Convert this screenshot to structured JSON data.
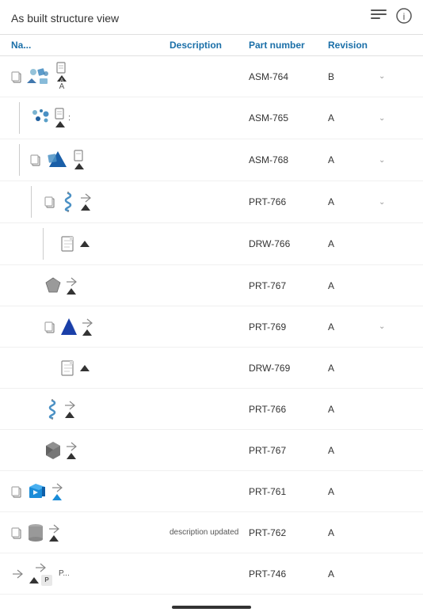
{
  "header": {
    "title": "As built structure view",
    "menu_icon": "≡",
    "info_icon": "ⓘ"
  },
  "columns": {
    "name": "Na...",
    "description": "Description",
    "part_number": "Part number",
    "revision": "Revision"
  },
  "rows": [
    {
      "id": "row-1",
      "indent": 0,
      "name": "A...",
      "description": "",
      "part_number": "ASM-764",
      "revision": "B",
      "has_expand": true,
      "type": "assembly"
    },
    {
      "id": "row-2",
      "indent": 1,
      "name": ":",
      "description": "",
      "part_number": "ASM-765",
      "revision": "A",
      "has_expand": true,
      "type": "sub-assembly"
    },
    {
      "id": "row-3",
      "indent": 1,
      "name": "",
      "description": "",
      "part_number": "ASM-768",
      "revision": "A",
      "has_expand": true,
      "type": "assembly2"
    },
    {
      "id": "row-4",
      "indent": 2,
      "name": "",
      "description": "",
      "part_number": "PRT-766",
      "revision": "A",
      "has_expand": true,
      "type": "spring"
    },
    {
      "id": "row-5",
      "indent": 3,
      "name": "",
      "description": "",
      "part_number": "DRW-766",
      "revision": "A",
      "has_expand": false,
      "type": "doc"
    },
    {
      "id": "row-6",
      "indent": 2,
      "name": "",
      "description": "",
      "part_number": "PRT-767",
      "revision": "A",
      "has_expand": false,
      "type": "prism"
    },
    {
      "id": "row-7",
      "indent": 2,
      "name": "",
      "description": "",
      "part_number": "PRT-769",
      "revision": "A",
      "has_expand": true,
      "type": "triangle"
    },
    {
      "id": "row-8",
      "indent": 3,
      "name": "",
      "description": "",
      "part_number": "DRW-769",
      "revision": "A",
      "has_expand": false,
      "type": "doc"
    },
    {
      "id": "row-9",
      "indent": 2,
      "name": "",
      "description": "",
      "part_number": "PRT-766",
      "revision": "A",
      "has_expand": false,
      "type": "spring"
    },
    {
      "id": "row-10",
      "indent": 2,
      "name": "",
      "description": "",
      "part_number": "PRT-767",
      "revision": "A",
      "has_expand": false,
      "type": "prism-grey"
    },
    {
      "id": "row-11",
      "indent": 0,
      "name": "",
      "description": "",
      "part_number": "PRT-761",
      "revision": "A",
      "has_expand": false,
      "type": "box"
    },
    {
      "id": "row-12",
      "indent": 0,
      "name": "",
      "description": "description updated",
      "part_number": "PRT-762",
      "revision": "A",
      "has_expand": false,
      "type": "cylinder"
    },
    {
      "id": "row-13",
      "indent": 0,
      "name": "P...",
      "description": "",
      "part_number": "PRT-746",
      "revision": "A",
      "has_expand": false,
      "type": "part-p"
    }
  ]
}
